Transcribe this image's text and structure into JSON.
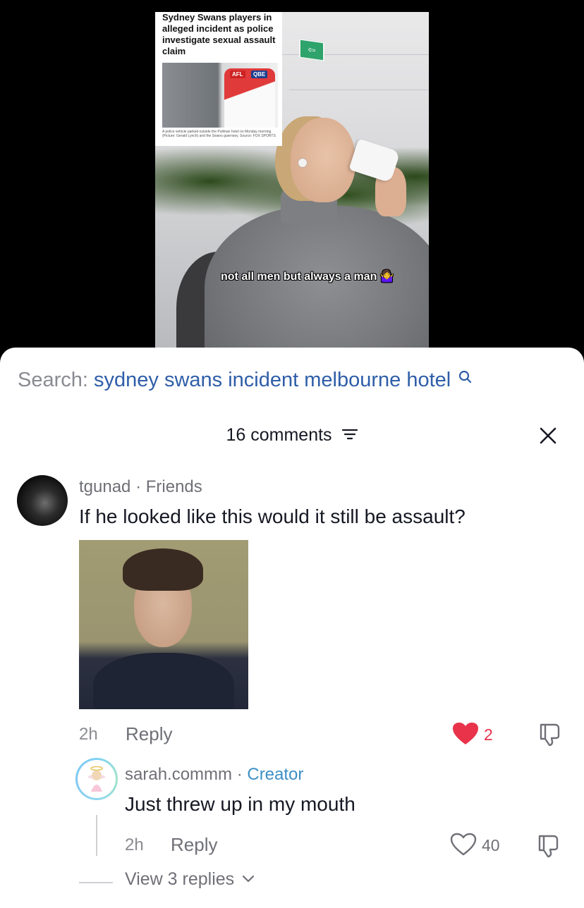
{
  "video": {
    "news_headline": "Sydney Swans players in alleged incident as police investigate sexual assault claim",
    "news_logo_afl": "AFL",
    "news_logo_qbe": "QBE",
    "news_caption": "A police vehicle parked outside the Pullman hotel on Monday morning (Picture: Gerald Lynch) and the Swans guernsey. Source: FOX SPORTS",
    "caption": "not all men but always a man 🤷‍♀️"
  },
  "search": {
    "prefix": "Search:",
    "query": "sydney swans incident melbourne hotel"
  },
  "comments_header": {
    "count_label": "16 comments"
  },
  "comments": [
    {
      "username": "tgunad",
      "separator": " · ",
      "relation": "Friends",
      "text": "If he looked like this would it still be assault?",
      "time": "2h",
      "reply_label": "Reply",
      "likes": "2",
      "liked": true
    },
    {
      "username": "sarah.commm",
      "separator": " · ",
      "relation": "Creator",
      "text": "Just threw up in my mouth",
      "time": "2h",
      "reply_label": "Reply",
      "likes": "40",
      "liked": false
    }
  ],
  "view_replies": "View 3 replies",
  "colors": {
    "like_active": "#e8334a",
    "search_query": "#2f5ea8",
    "creator_label": "#3d8fc6",
    "muted_text": "#6f7077"
  },
  "icons": [
    "search-icon",
    "filter-icon",
    "close-icon",
    "heart-filled-icon",
    "heart-outline-icon",
    "dislike-icon",
    "chevron-down-icon"
  ]
}
